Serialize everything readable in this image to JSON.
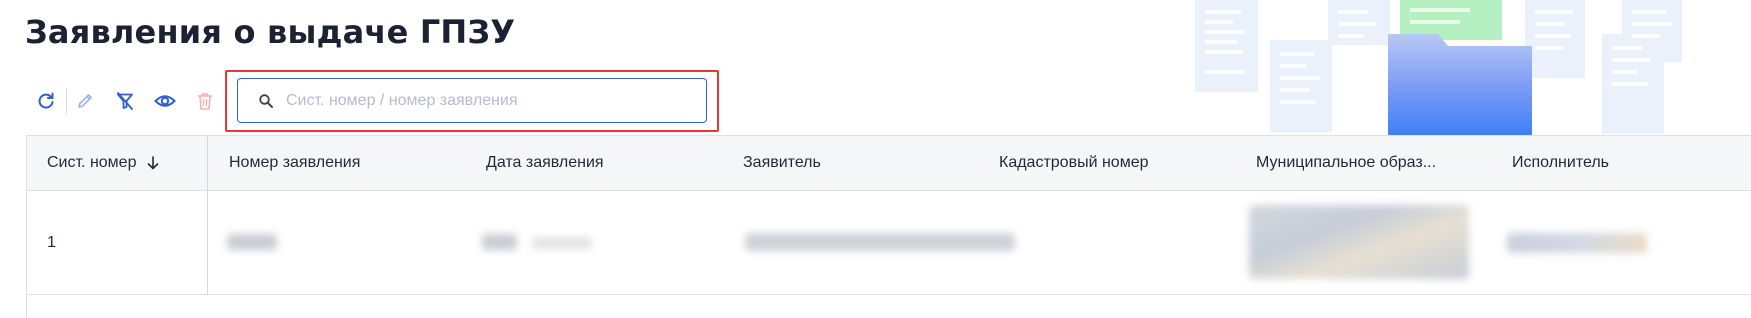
{
  "page": {
    "title": "Заявления о выдаче ГПЗУ"
  },
  "toolbar": {
    "buttons": [
      {
        "name": "refresh",
        "icon": "refresh-icon",
        "color": "#2f5fd0",
        "enabled": true
      },
      {
        "name": "edit",
        "icon": "pencil-icon",
        "color": "#9fb3e6",
        "enabled": false
      },
      {
        "name": "clear-filter",
        "icon": "filter-clear-icon",
        "color": "#2f5fd0",
        "enabled": true
      },
      {
        "name": "view",
        "icon": "eye-icon",
        "color": "#2f5fd0",
        "enabled": true
      },
      {
        "name": "delete",
        "icon": "trash-icon",
        "color": "#f3b1b1",
        "enabled": false
      }
    ]
  },
  "search": {
    "placeholder": "Сист. номер / номер заявления",
    "value": "",
    "icon": "search-icon"
  },
  "table": {
    "columns": [
      {
        "label": "Сист. номер",
        "sort": "desc",
        "sort_icon": "arrow-down-icon"
      },
      {
        "label": "Номер заявления"
      },
      {
        "label": "Дата заявления"
      },
      {
        "label": "Заявитель"
      },
      {
        "label": "Кадастровый номер"
      },
      {
        "label": "Муниципальное образ..."
      },
      {
        "label": "Исполнитель"
      }
    ],
    "rows": [
      {
        "sys_number": "1"
      }
    ]
  },
  "colors": {
    "accent": "#2f5fd0",
    "highlight": "#e53935",
    "header_bg": "#f5f6f8"
  }
}
